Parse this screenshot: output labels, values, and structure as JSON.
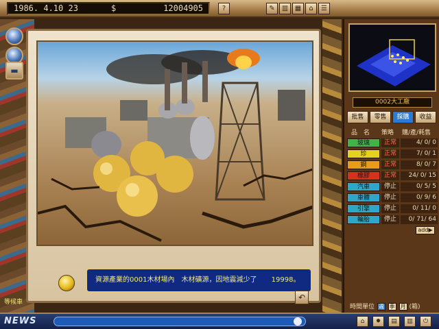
{
  "status": {
    "date": "1986. 4.10 23",
    "currency_symbol": "$",
    "money": "12004905"
  },
  "toolbar": {
    "help_icon": "help-icon",
    "buttons": [
      "edit-icon",
      "chart-icon",
      "grid-icon",
      "bank-icon",
      "book-icon"
    ]
  },
  "left": {
    "waiting_label": "等候車"
  },
  "popup": {
    "message": "資源產業的0001木材場內　木材礦源，因地震減少了",
    "amount": "19998。"
  },
  "panel": {
    "factory_title": "0002大工廠",
    "tabs": [
      "批售",
      "零售",
      "採購",
      "收益"
    ],
    "active_tab": 2,
    "header": {
      "name": "品　名",
      "policy": "策略",
      "columns": "購/產/耗售"
    },
    "rows": [
      {
        "name": "玻璃",
        "color": "#3fb548",
        "status": "正常",
        "nums": "4/ 0/ 0"
      },
      {
        "name": "珍",
        "color": "#e3d21e",
        "status": "正常",
        "nums": "7/ 0/ 1"
      },
      {
        "name": "鋼",
        "color": "#e99b1c",
        "status": "正常",
        "nums": "8/ 0/ 7"
      },
      {
        "name": "橡膠",
        "color": "#d6301e",
        "status": "正常",
        "nums": "24/ 0/ 15"
      },
      {
        "name": "汽車",
        "color": "#2fa7c9",
        "status": "停止",
        "nums": "0/ 5/ 5"
      },
      {
        "name": "車體",
        "color": "#2fa7c9",
        "status": "停止",
        "nums": "0/ 9/ 6"
      },
      {
        "name": "引擎",
        "color": "#2fa7c9",
        "status": "停止",
        "nums": "0/ 11/ 0"
      },
      {
        "name": "輪胎",
        "color": "#2fa7c9",
        "status": "停止",
        "nums": "0/ 71/ 64"
      }
    ],
    "add_label": "add▶",
    "time_unit_label": "時間單位",
    "time_options": [
      "週",
      "季",
      "月"
    ],
    "time_selected": 0,
    "time_suffix": "(箱)"
  },
  "news": {
    "label": "NEWS"
  },
  "bottom_buttons": [
    "house-icon",
    "gear-icon",
    "office-icon",
    "factory-icon",
    "power-icon"
  ]
}
